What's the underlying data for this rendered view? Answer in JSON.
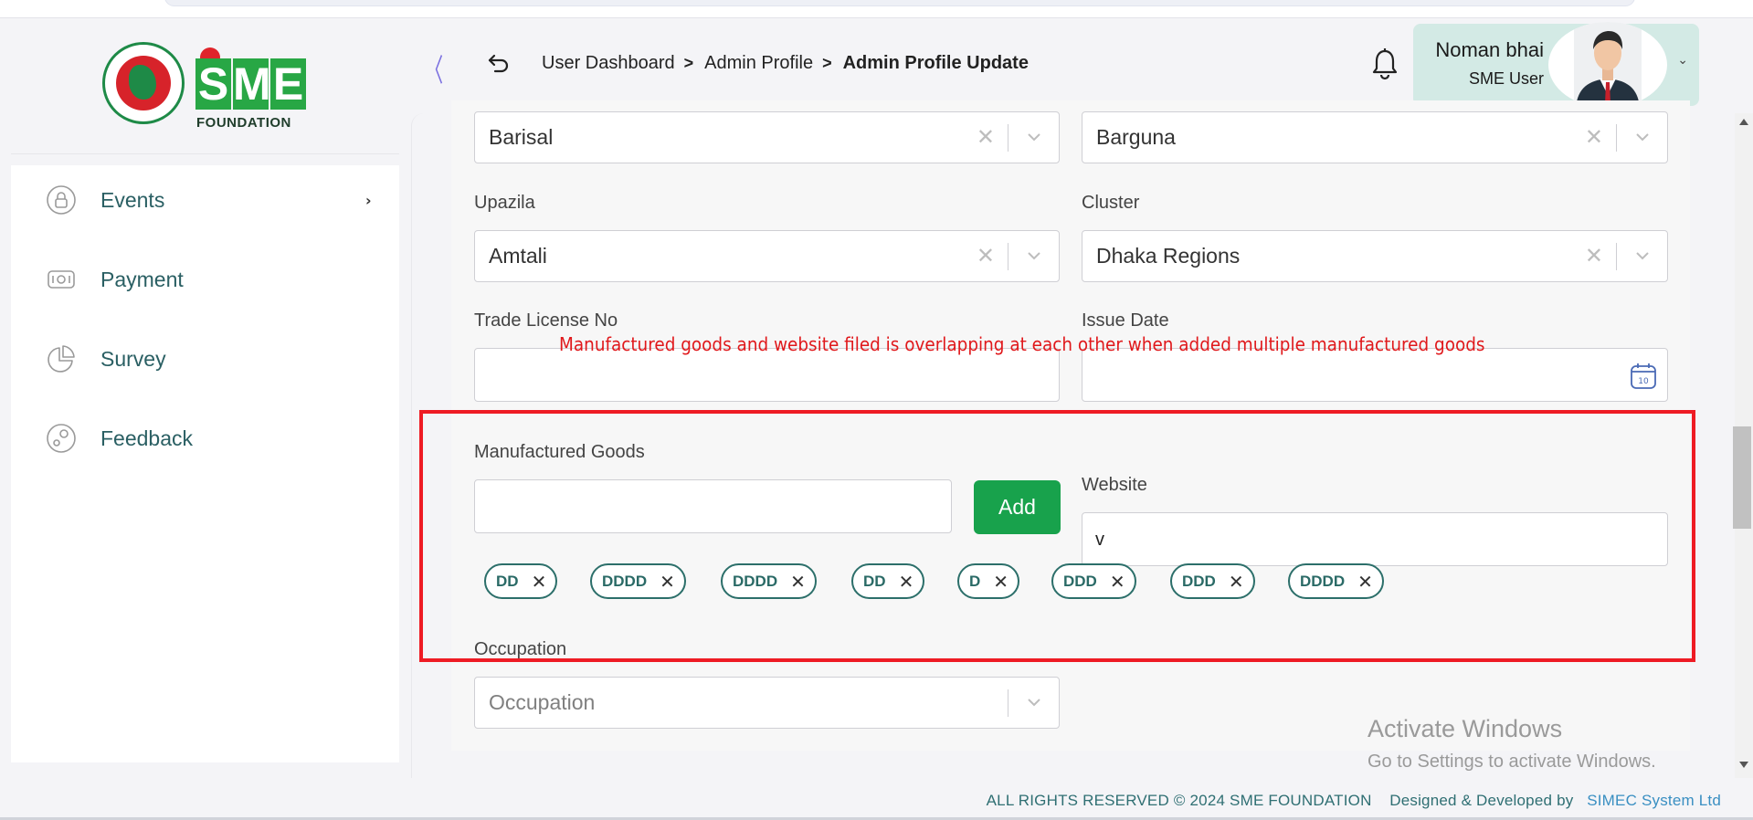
{
  "header": {
    "logo_text_brand": "SME",
    "logo_text_sub": "FOUNDATION",
    "breadcrumb": [
      {
        "label": "User Dashboard"
      },
      {
        "label": "Admin Profile"
      },
      {
        "label": "Admin Profile Update"
      }
    ],
    "user": {
      "name": "Noman bhai",
      "role": "SME User"
    }
  },
  "sidebar": {
    "items": [
      {
        "label": "Events",
        "icon": "lock-icon",
        "has_submenu": true
      },
      {
        "label": "Payment",
        "icon": "cash-icon",
        "has_submenu": false
      },
      {
        "label": "Survey",
        "icon": "pie-chart-icon",
        "has_submenu": false
      },
      {
        "label": "Feedback",
        "icon": "feedback-icon",
        "has_submenu": false
      }
    ]
  },
  "form": {
    "division": {
      "value": "Barisal"
    },
    "district": {
      "value": "Barguna"
    },
    "upazila": {
      "label": "Upazila",
      "value": "Amtali"
    },
    "cluster": {
      "label": "Cluster",
      "value": "Dhaka Regions"
    },
    "trade_license": {
      "label": "Trade License No",
      "value": ""
    },
    "issue_date": {
      "label": "Issue Date",
      "value": ""
    },
    "manufactured_goods": {
      "label": "Manufactured Goods",
      "value": "",
      "add_label": "Add",
      "chips": [
        "DD",
        "DDDD",
        "DDDD",
        "DD",
        "D",
        "DDD",
        "DDD",
        "DDDD"
      ]
    },
    "website": {
      "label": "Website",
      "value": "v"
    },
    "occupation": {
      "label": "Occupation",
      "placeholder": "Occupation"
    }
  },
  "annotation": {
    "text": "Manufactured goods and website filed is overlapping at each other when added multiple manufactured goods",
    "color": "#ee1b24"
  },
  "watermark": {
    "title": "Activate Windows",
    "subtitle": "Go to Settings to activate Windows."
  },
  "footer": {
    "rights": "ALL RIGHTS RESERVED © 2024 SME FOUNDATION",
    "designed_by": "Designed & Developed by",
    "company": "SIMEC System Ltd"
  },
  "colors": {
    "accent_green": "#18a24c",
    "chip_border": "#2c6f6a",
    "sidebar_text": "#2a5f63",
    "user_card_bg": "#d3eae5"
  }
}
